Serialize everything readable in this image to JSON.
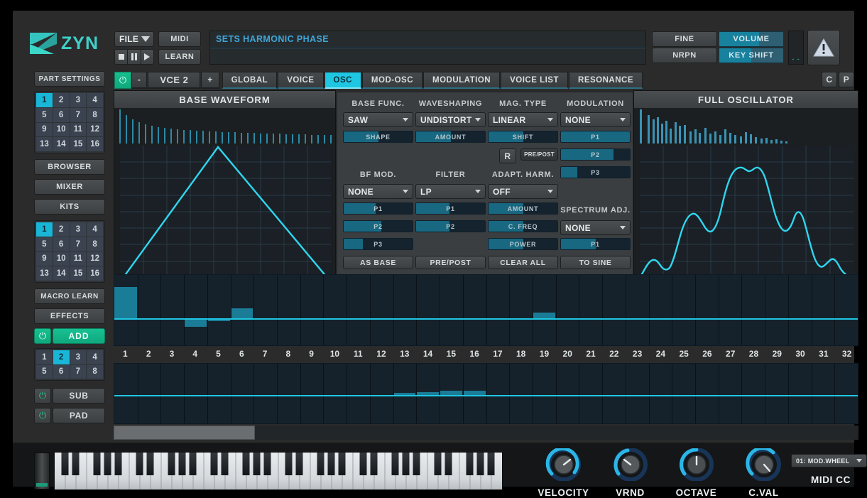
{
  "app": {
    "logo_text": "ZYN"
  },
  "header": {
    "file_button": "FILE",
    "midi_button": "MIDI",
    "learn_button": "LEARN",
    "transport": {
      "stop": "stop-icon",
      "pause": "pause-icon",
      "play": "play-icon"
    },
    "title_field_value": "SETS HARMONIC PHASE",
    "subtitle_field_value": "",
    "fine_button": "FINE",
    "nrpn_button": "NRPN",
    "volume_slider": {
      "label": "VOLUME",
      "fill_pct": 62
    },
    "keyshift_slider": {
      "label": "KEY SHIFT",
      "fill_pct": 50
    },
    "meter_label": "- -",
    "warning_icon": "warning-icon",
    "c_button": "C",
    "p_button": "P"
  },
  "sidebar": {
    "part_settings": "PART SETTINGS",
    "part_grid": {
      "cells": [
        "1",
        "2",
        "3",
        "4",
        "5",
        "6",
        "7",
        "8",
        "9",
        "10",
        "11",
        "12",
        "13",
        "14",
        "15",
        "16"
      ],
      "selected": "1"
    },
    "browser": "BROWSER",
    "mixer": "MIXER",
    "kits": "KITS",
    "kit_grid": {
      "cells": [
        "1",
        "2",
        "3",
        "4",
        "5",
        "6",
        "7",
        "8",
        "9",
        "10",
        "11",
        "12",
        "13",
        "14",
        "15",
        "16"
      ],
      "selected": "1"
    },
    "macro_learn": "MACRO LEARN",
    "effects": "EFFECTS",
    "add_button": {
      "label": "ADD",
      "enabled": true,
      "power_icon": "power-icon"
    },
    "voice_grid": {
      "cells": [
        "1",
        "2",
        "3",
        "4",
        "5",
        "6",
        "7",
        "8"
      ],
      "selected": "2"
    },
    "sub_button": {
      "label": "SUB",
      "enabled": false,
      "power_icon": "power-icon"
    },
    "pad_button": {
      "label": "PAD",
      "enabled": false,
      "power_icon": "power-icon"
    }
  },
  "voicebar": {
    "power_icon": "power-icon",
    "minus": "-",
    "voice_label": "VCE 2",
    "plus": "+",
    "tabs": [
      {
        "label": "GLOBAL",
        "active": false
      },
      {
        "label": "VOICE",
        "active": false
      },
      {
        "label": "OSC",
        "active": true
      },
      {
        "label": "MOD-OSC",
        "active": false
      },
      {
        "label": "MODULATION",
        "active": false
      },
      {
        "label": "VOICE LIST",
        "active": false
      },
      {
        "label": "RESONANCE",
        "active": false
      }
    ]
  },
  "base_waveform": {
    "title": "BASE WAVEFORM"
  },
  "full_oscillator": {
    "title": "FULL OSCILLATOR"
  },
  "osc_editor": {
    "col_headings_top": [
      "BASE FUNC.",
      "WAVESHAPING",
      "MAG. TYPE",
      "MODULATION"
    ],
    "col_headings_mid": [
      "BF MOD.",
      "FILTER",
      "ADAPT. HARM."
    ],
    "spectrum_adj_label": "SPECTRUM ADJ.",
    "base_func": {
      "value": "SAW",
      "slider": {
        "label": "SHAPE",
        "fill_pct": 50
      }
    },
    "waveshaping": {
      "value": "UNDISTORT",
      "slider": {
        "label": "AMOUNT",
        "fill_pct": 50
      }
    },
    "mag_type": {
      "value": "LINEAR",
      "slider": {
        "label": "SHIFT",
        "fill_pct": 50
      },
      "r_button": "R",
      "prepost_button": "PRE/POST"
    },
    "modulation": {
      "value": "NONE",
      "sliders": [
        {
          "label": "P1",
          "fill_pct": 100
        },
        {
          "label": "P2",
          "fill_pct": 76
        },
        {
          "label": "P3",
          "fill_pct": 24
        }
      ]
    },
    "bf_mod": {
      "value": "NONE",
      "sliders": [
        {
          "label": "P1",
          "fill_pct": 46
        },
        {
          "label": "P2",
          "fill_pct": 55
        },
        {
          "label": "P3",
          "fill_pct": 28
        }
      ],
      "action": "AS BASE"
    },
    "filter": {
      "value": "LP",
      "sliders": [
        {
          "label": "P1",
          "fill_pct": 48
        },
        {
          "label": "P2",
          "fill_pct": 48
        }
      ],
      "action": "PRE/POST"
    },
    "adapt_harm": {
      "value": "OFF",
      "sliders": [
        {
          "label": "AMOUNT",
          "fill_pct": 50
        },
        {
          "label": "C. FREQ",
          "fill_pct": 50
        },
        {
          "label": "POWER",
          "fill_pct": 50
        }
      ],
      "action": "CLEAR ALL"
    },
    "spectrum_adj": {
      "value": "NONE",
      "sliders": [
        {
          "label": "P1",
          "fill_pct": 50
        }
      ],
      "action": "TO SINE"
    }
  },
  "harmonics": {
    "axis_labels": [
      "1",
      "2",
      "3",
      "4",
      "5",
      "6",
      "7",
      "8",
      "9",
      "10",
      "11",
      "12",
      "13",
      "14",
      "15",
      "16",
      "17",
      "18",
      "19",
      "20",
      "21",
      "22",
      "23",
      "24",
      "25",
      "26",
      "27",
      "28",
      "29",
      "30",
      "31",
      "32"
    ],
    "magnitude_values": [
      0.88,
      0,
      0,
      -0.22,
      -0.06,
      0.3,
      0,
      0.02,
      0.02,
      0,
      0,
      0,
      0,
      0,
      0,
      0,
      0,
      0,
      0.17,
      0,
      0,
      0,
      0,
      0,
      0,
      0,
      0,
      0,
      0,
      0,
      0,
      0
    ],
    "phase_values": [
      0.01,
      0.01,
      0.02,
      0.03,
      0.02,
      0.02,
      0.02,
      0.01,
      0.01,
      0.01,
      0.01,
      0.01,
      0.1,
      0.12,
      0.16,
      0.15,
      0,
      0,
      0,
      0,
      0,
      0,
      0,
      0,
      0,
      0,
      0,
      0,
      0,
      0,
      0,
      0
    ],
    "scrollbar_position_pct": 0,
    "scrollbar_width_pct": 19
  },
  "bottom": {
    "wheel": "mod-wheel",
    "keyboard": "piano-keyboard",
    "knobs": [
      {
        "label": "VELOCITY",
        "angle_deg": 40,
        "arc_pct": 68
      },
      {
        "label": "VRND",
        "angle_deg": -45,
        "arc_pct": 30
      },
      {
        "label": "OCTAVE",
        "angle_deg": 0,
        "arc_pct": 50
      },
      {
        "label": "C.VAL",
        "angle_deg": 120,
        "arc_pct": 56
      }
    ],
    "midi_cc": {
      "label": "MIDI CC",
      "value": "01: MOD.WHEEL"
    }
  },
  "colors": {
    "accent_cyan": "#1fc6e2",
    "accent_green": "#16bf8e",
    "slider_fill": "#186881",
    "panel_bg": "#3a3e40",
    "scope_bg": "#1b1f21",
    "harm_bg": "#15222c"
  }
}
